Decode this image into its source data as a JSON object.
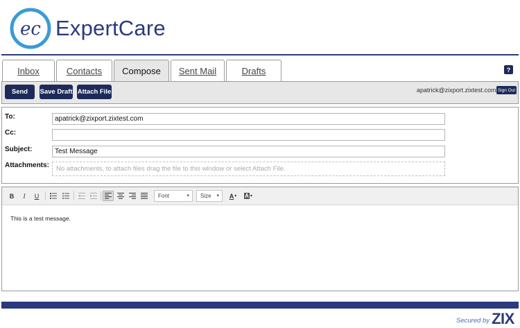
{
  "brand": {
    "name": "ExpertCare",
    "monogram": "ec"
  },
  "tabs": [
    {
      "label": "Inbox",
      "active": false
    },
    {
      "label": "Contacts",
      "active": false
    },
    {
      "label": "Compose",
      "active": true
    },
    {
      "label": "Sent Mail",
      "active": false
    },
    {
      "label": "Drafts",
      "active": false
    }
  ],
  "help_label": "?",
  "toolbar": {
    "send_label": "Send",
    "save_draft_label": "Save Draft",
    "attach_file_label": "Attach File",
    "user_email": "apatrick@zixport.zixtest.com",
    "sign_out_label": "Sign Out"
  },
  "compose": {
    "to_label": "To:",
    "to_value": "apatrick@zixport.zixtest.com",
    "cc_label": "Cc:",
    "cc_value": "",
    "subject_label": "Subject:",
    "subject_value": "Test Message",
    "attachments_label": "Attachments:",
    "attachments_placeholder": "No attachments, to attach files drag the file to this window or select Attach File."
  },
  "editor": {
    "bold": "B",
    "italic": "I",
    "underline": "U",
    "font_select": "Font",
    "size_select": "Size",
    "text_color": "A",
    "bg_color": "A",
    "body_text": "This is a test message."
  },
  "footer": {
    "secured_by": "Secured by",
    "zix": "ZIX"
  },
  "colors": {
    "brand_navy": "#2b3a7d",
    "button_navy": "#1d2a5a",
    "logo_blue": "#3a9bd6"
  }
}
